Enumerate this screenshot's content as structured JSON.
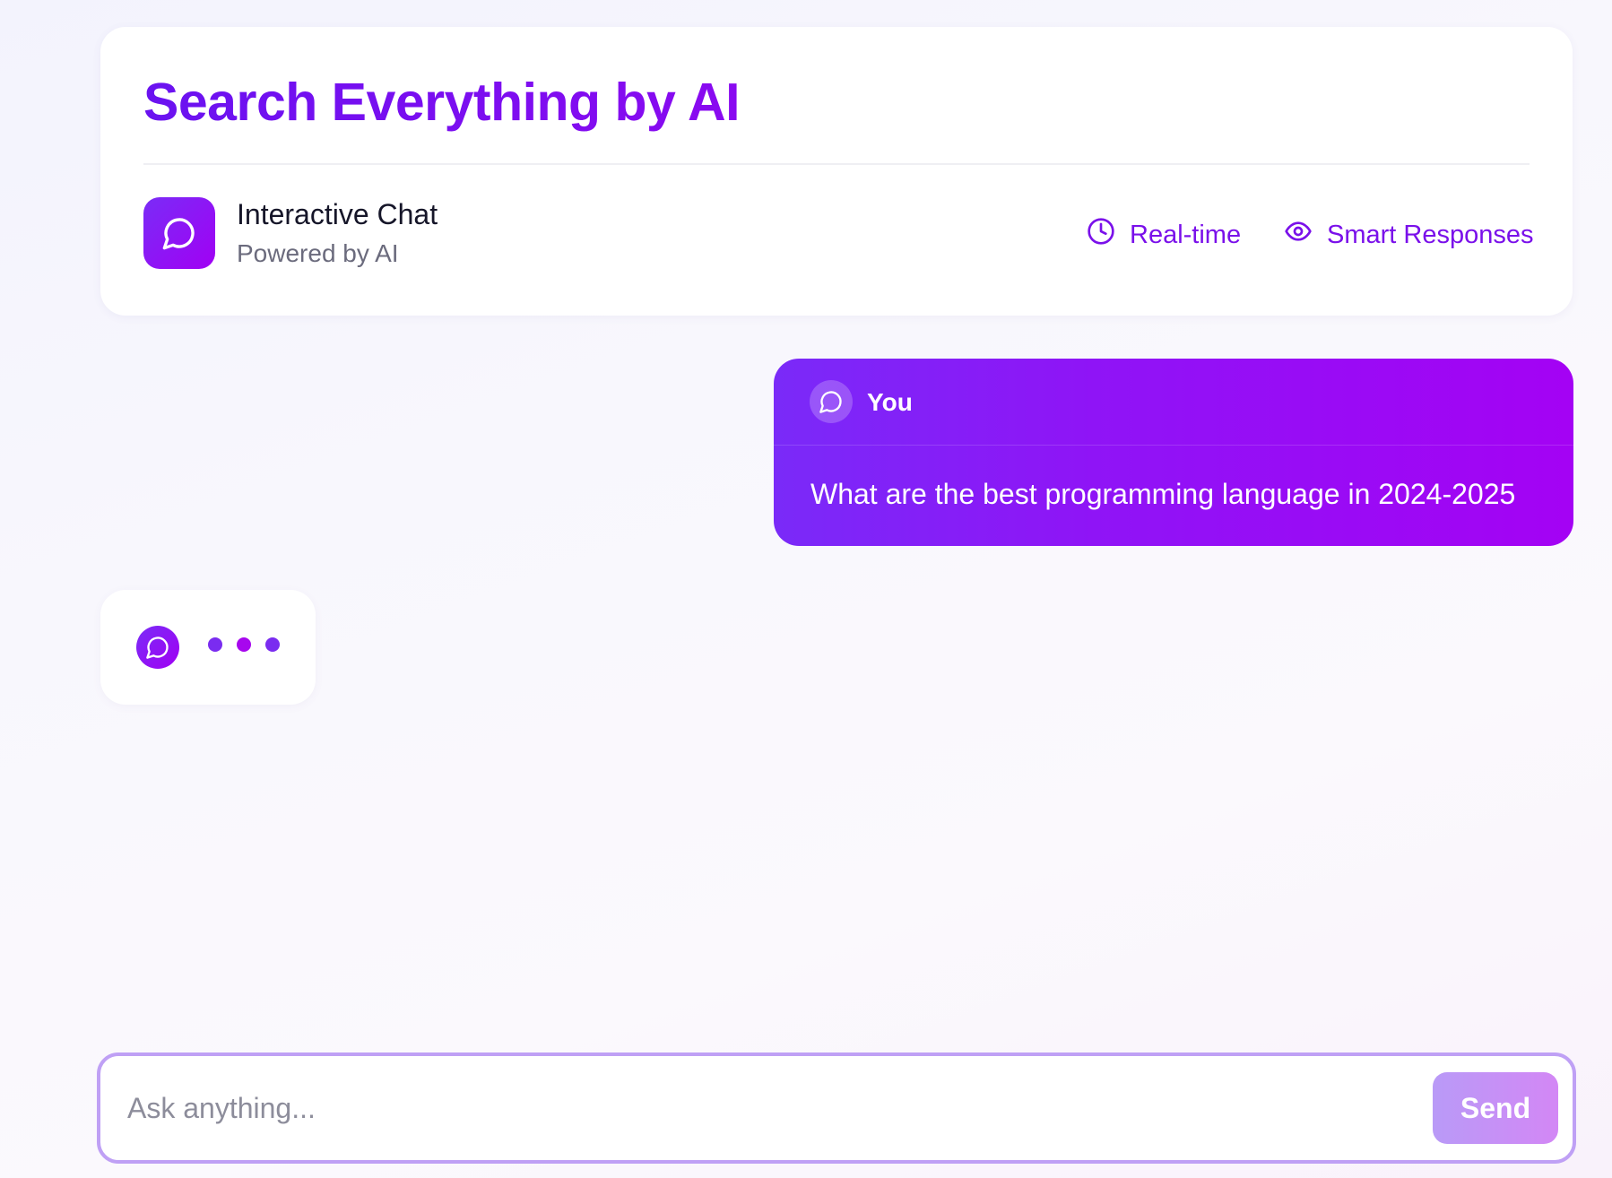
{
  "header": {
    "title": "Search Everything by AI",
    "brand": {
      "icon": "chat-bubble-icon",
      "title": "Interactive Chat",
      "subtitle": "Powered by AI"
    },
    "features": [
      {
        "icon": "clock-icon",
        "label": "Real-time"
      },
      {
        "icon": "eye-icon",
        "label": "Smart Responses"
      }
    ]
  },
  "conversation": {
    "messages": [
      {
        "role": "user",
        "sender": "You",
        "avatar_icon": "chat-bubble-icon",
        "text": "What are the best programming language in 2024-2025"
      }
    ],
    "typing_indicator": {
      "avatar_icon": "chat-bubble-icon",
      "dots": 3
    }
  },
  "composer": {
    "placeholder": "Ask anything...",
    "value": "",
    "send_label": "Send"
  },
  "colors": {
    "accent": "#7a10ea",
    "accent_end": "#a100f4",
    "input_border": "#bfa0f5",
    "send_button_start": "#b99af7",
    "send_button_end": "#d387f5"
  }
}
